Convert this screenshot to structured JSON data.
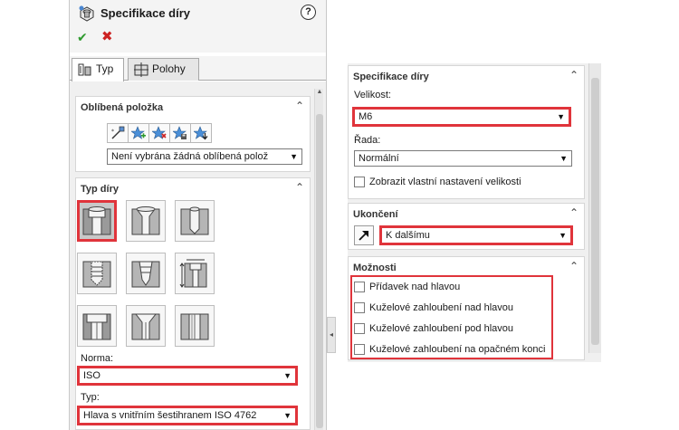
{
  "property_manager": {
    "title": "Specifikace díry",
    "help_label": "?",
    "ok_symbol": "✔",
    "cancel_symbol": "✖",
    "tabs": [
      {
        "label": "Typ",
        "icon": "hole-type-icon",
        "active": true
      },
      {
        "label": "Polohy",
        "icon": "positions-icon",
        "active": false
      }
    ]
  },
  "favorites": {
    "title": "Oblíbená položka",
    "icons": [
      "apply-defaults-icon",
      "add-favorite-icon",
      "delete-favorite-icon",
      "save-favorite-icon",
      "load-favorite-icon"
    ],
    "selected": "Není vybrána žádná oblíbená polož"
  },
  "hole_type": {
    "title": "Typ díry",
    "buttons": [
      {
        "name": "counterbore-icon",
        "selected": true
      },
      {
        "name": "countersink-icon",
        "selected": false
      },
      {
        "name": "hole-icon",
        "selected": false
      },
      {
        "name": "straight-tap-icon",
        "selected": false
      },
      {
        "name": "tapered-tap-icon",
        "selected": false
      },
      {
        "name": "legacy-hole-icon",
        "selected": false
      },
      {
        "name": "counterbore-slot-icon",
        "selected": false
      },
      {
        "name": "countersink-slot-icon",
        "selected": false
      },
      {
        "name": "slot-icon",
        "selected": false
      }
    ],
    "norma_label": "Norma:",
    "norma_value": "ISO",
    "typ_label": "Typ:",
    "typ_value": "Hlava s vnitřním šestihranem ISO 4762"
  },
  "spec": {
    "title": "Specifikace díry",
    "size_label": "Velikost:",
    "size_value": "M6",
    "series_label": "Řada:",
    "series_value": "Normální",
    "custom_size_label": "Zobrazit vlastní nastavení velikosti"
  },
  "end_condition": {
    "title": "Ukončení",
    "icon": "direction-arrow-icon",
    "value": "K dalšímu"
  },
  "options": {
    "title": "Možnosti",
    "items": [
      "Přídavek nad hlavou",
      "Kuželové zahloubení nad hlavou",
      "Kuželové zahloubení pod hlavou",
      "Kuželové zahloubení na opačném konci"
    ]
  },
  "colors": {
    "highlight": "#e0343b",
    "ok": "#2e9a2e",
    "cancel": "#cc2222",
    "panel_bg": "#f0f0f0"
  }
}
